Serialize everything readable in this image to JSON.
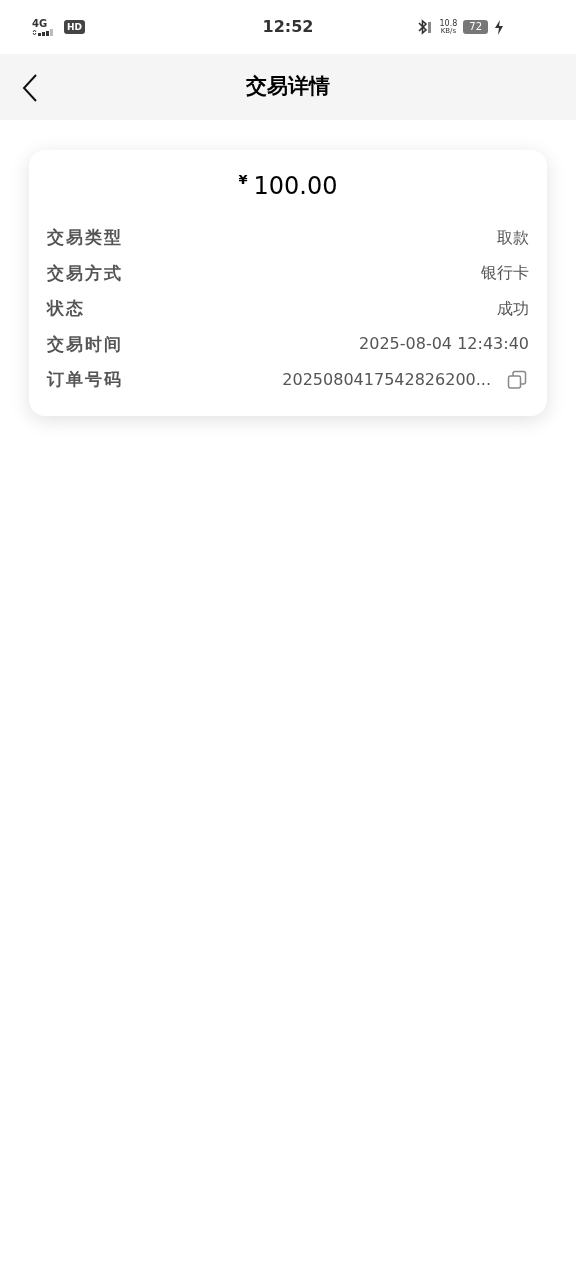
{
  "status_bar": {
    "network": "4G",
    "hd": "HD",
    "time": "12:52",
    "speed": "10.8",
    "speed_unit": "KB/s",
    "battery": "72"
  },
  "header": {
    "title": "交易详情"
  },
  "amount": {
    "currency": "¥",
    "value": "100.00"
  },
  "rows": [
    {
      "label": "交易类型",
      "value": "取款",
      "copy_button": false
    },
    {
      "label": "交易方式",
      "value": "银行卡",
      "copy_button": false
    },
    {
      "label": "状态",
      "value": "成功",
      "copy_button": false
    },
    {
      "label": "交易时间",
      "value": "2025-08-04 12:43:40",
      "copy_button": false
    },
    {
      "label": "订单号码",
      "value": "2025080417542826200...",
      "copy_button": true
    }
  ]
}
